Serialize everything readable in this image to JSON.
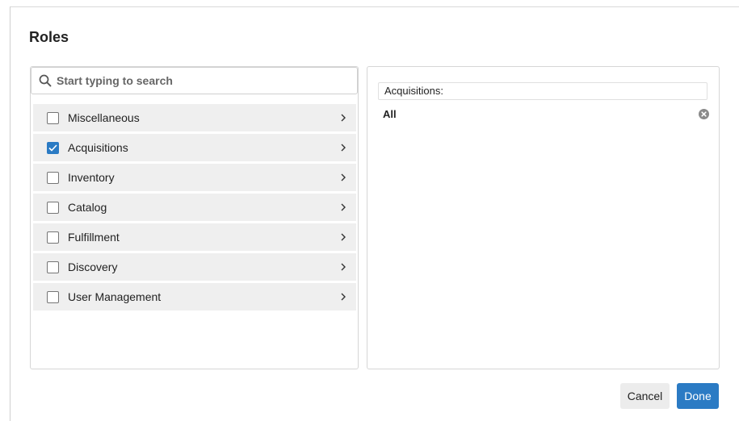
{
  "dialog": {
    "title": "Roles"
  },
  "search": {
    "placeholder": "Start typing to search",
    "value": ""
  },
  "roles": [
    {
      "label": "Miscellaneous",
      "checked": false
    },
    {
      "label": "Acquisitions",
      "checked": true
    },
    {
      "label": "Inventory",
      "checked": false
    },
    {
      "label": "Catalog",
      "checked": false
    },
    {
      "label": "Fulfillment",
      "checked": false
    },
    {
      "label": "Discovery",
      "checked": false
    },
    {
      "label": "User Management",
      "checked": false
    }
  ],
  "selected": {
    "group_header": "Acquisitions:",
    "items": [
      {
        "label": "All"
      }
    ]
  },
  "actions": {
    "cancel_label": "Cancel",
    "done_label": "Done"
  },
  "colors": {
    "accent": "#2b7bc4",
    "row_background": "#efefef",
    "cancel_background": "#ececec"
  },
  "icons": {
    "search": "search-icon",
    "chevron": "chevron-right-icon",
    "checkmark": "checkmark-icon",
    "remove": "remove-circle-icon"
  }
}
